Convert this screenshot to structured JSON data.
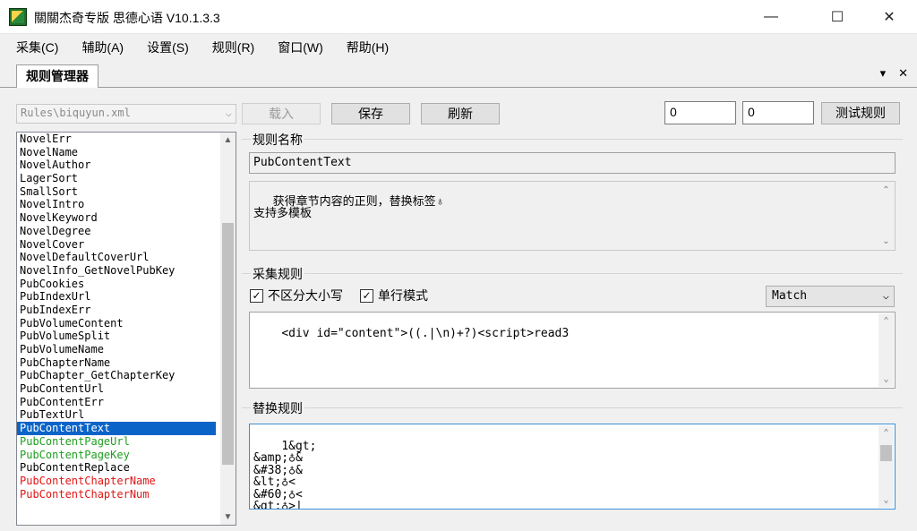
{
  "window": {
    "title": "關關杰奇专版 思德心语 V10.1.3.3",
    "minimize": "—",
    "maximize": "☐",
    "close": "✕"
  },
  "menu": [
    "采集(C)",
    "辅助(A)",
    "设置(S)",
    "规则(R)",
    "窗口(W)",
    "帮助(H)"
  ],
  "tab": {
    "label": "规则管理器",
    "dropdown_glyph": "▾",
    "close_glyph": "✕"
  },
  "toolbar": {
    "file_combo_value": "Rules\\biquyun.xml",
    "load_label": "载入",
    "save_label": "保存",
    "refresh_label": "刷新",
    "num1": "0",
    "num2": "0",
    "test_label": "测试规则"
  },
  "rule_list": {
    "items": [
      {
        "label": "NovelErr",
        "style": "normal"
      },
      {
        "label": "NovelName",
        "style": "normal"
      },
      {
        "label": "NovelAuthor",
        "style": "normal"
      },
      {
        "label": "LagerSort",
        "style": "normal"
      },
      {
        "label": "SmallSort",
        "style": "normal"
      },
      {
        "label": "NovelIntro",
        "style": "normal"
      },
      {
        "label": "NovelKeyword",
        "style": "normal"
      },
      {
        "label": "NovelDegree",
        "style": "normal"
      },
      {
        "label": "NovelCover",
        "style": "normal"
      },
      {
        "label": "NovelDefaultCoverUrl",
        "style": "normal"
      },
      {
        "label": "NovelInfo_GetNovelPubKey",
        "style": "normal"
      },
      {
        "label": "PubCookies",
        "style": "normal"
      },
      {
        "label": "PubIndexUrl",
        "style": "normal"
      },
      {
        "label": "PubIndexErr",
        "style": "normal"
      },
      {
        "label": "PubVolumeContent",
        "style": "normal"
      },
      {
        "label": "PubVolumeSplit",
        "style": "normal"
      },
      {
        "label": "PubVolumeName",
        "style": "normal"
      },
      {
        "label": "PubChapterName",
        "style": "normal"
      },
      {
        "label": "PubChapter_GetChapterKey",
        "style": "normal"
      },
      {
        "label": "PubContentUrl",
        "style": "normal"
      },
      {
        "label": "PubContentErr",
        "style": "normal"
      },
      {
        "label": "PubTextUrl",
        "style": "normal"
      },
      {
        "label": "PubContentText",
        "style": "selected"
      },
      {
        "label": "PubContentPageUrl",
        "style": "green"
      },
      {
        "label": "PubContentPageKey",
        "style": "green"
      },
      {
        "label": "PubContentReplace",
        "style": "normal"
      },
      {
        "label": "PubContentChapterName",
        "style": "red"
      },
      {
        "label": "PubContentChapterNum",
        "style": "red"
      }
    ],
    "scroll_fraction": 0.62
  },
  "rule_name_group": {
    "title": "规则名称",
    "name_value": "PubContentText",
    "description": "获得章节内容的正则，替换标签♁\n支持多模板"
  },
  "collect_group": {
    "title": "采集规则",
    "case_insensitive_label": "不区分大小写",
    "case_insensitive_checked": true,
    "single_line_label": "单行模式",
    "single_line_checked": true,
    "mode_value": "Match",
    "pattern": "<div id=\"content\">((.|\\n)+?)<script>read3"
  },
  "replace_group": {
    "title": "替换规则",
    "lines": "1&gt;\n&amp;♁&\n&#38;♁&\n&lt;♁<\n&#60;♁<\n&gt;♁>|"
  },
  "colors": {
    "selected_bg": "#0a64c8",
    "green_item": "#1f9e1f",
    "red_item": "#e01515"
  }
}
